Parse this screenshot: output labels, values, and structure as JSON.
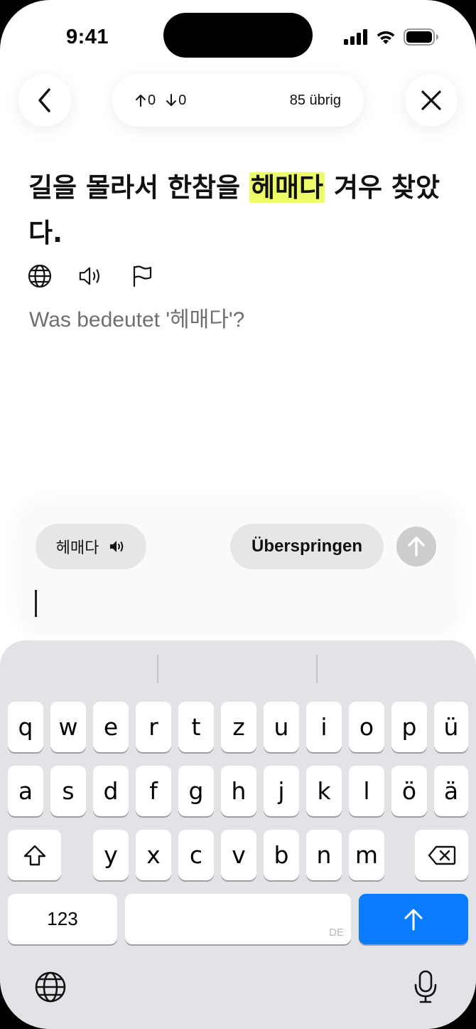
{
  "status": {
    "time": "9:41"
  },
  "nav": {
    "up_count": "0",
    "down_count": "0",
    "remaining": "85 übrig"
  },
  "sentence": {
    "before": "길을 몰라서 한참을 ",
    "highlight": "헤매다",
    "after": " 겨우 찾았다."
  },
  "question": "Was bedeutet '헤매다'?",
  "answer": {
    "word_chip": "헤매다",
    "skip_label": "Überspringen",
    "input_value": ""
  },
  "keyboard": {
    "row1": [
      "q",
      "w",
      "e",
      "r",
      "t",
      "z",
      "u",
      "i",
      "o",
      "p",
      "ü"
    ],
    "row2": [
      "a",
      "s",
      "d",
      "f",
      "g",
      "h",
      "j",
      "k",
      "l",
      "ö",
      "ä"
    ],
    "row3": [
      "y",
      "x",
      "c",
      "v",
      "b",
      "n",
      "m"
    ],
    "numbers_label": "123",
    "language_tag": "DE"
  },
  "colors": {
    "highlight": "#eefc6a",
    "return_key": "#0a7cff",
    "send_button_disabled": "#cdcdcd"
  }
}
